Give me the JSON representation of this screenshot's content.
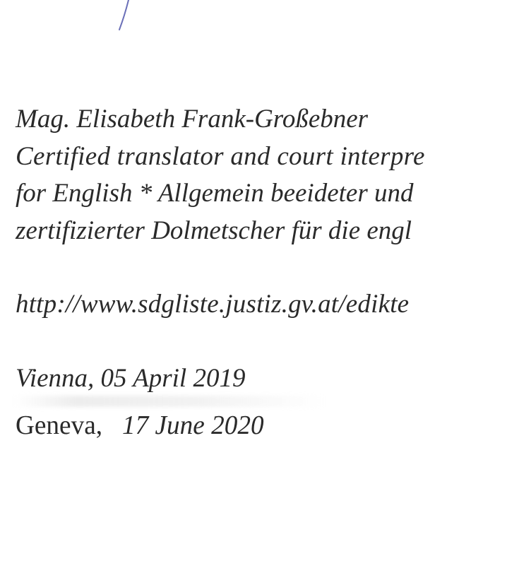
{
  "document": {
    "translator_name": "Mag. Elisabeth Frank-Großebner",
    "qualification_line_1": "Certified translator and court interpre",
    "qualification_line_2": "for English * Allgemein beeideter und",
    "qualification_line_3": "zertifizierter Dolmetscher für die engl",
    "registry_url": "http://www.sdgliste.justiz.gv.at/edikte",
    "place_date_1": "Vienna, 05 April 2019",
    "place_2": "Geneva,",
    "date_2": "17 June 2020"
  }
}
